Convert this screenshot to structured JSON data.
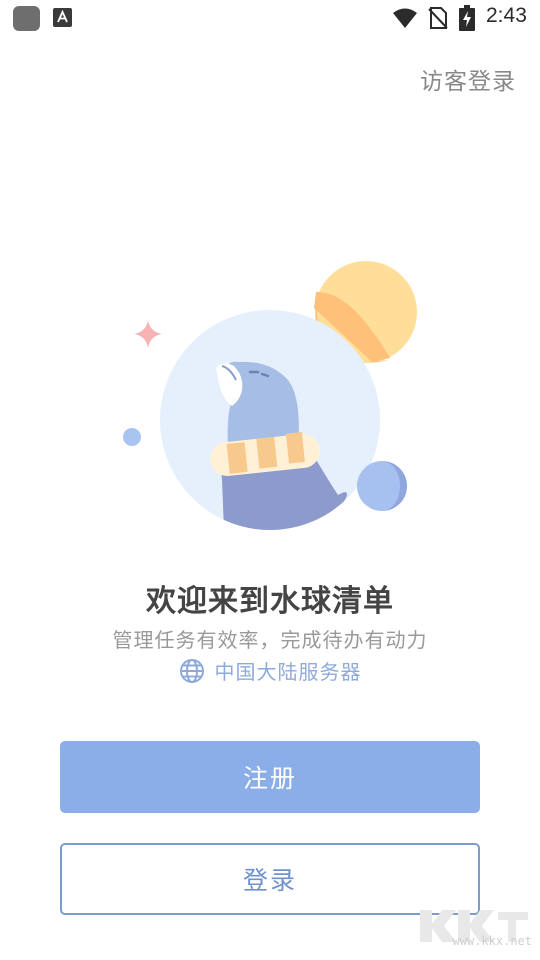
{
  "status_bar": {
    "time": "2:43",
    "icons": [
      "app-icon",
      "font-icon",
      "wifi-icon",
      "no-sim-icon",
      "battery-charging-icon"
    ]
  },
  "header": {
    "guest_login": "访客登录"
  },
  "welcome": {
    "title": "欢迎来到水球清单",
    "subtitle": "管理任务有效率，完成待办有动力",
    "server_icon": "globe-icon",
    "server_label": "中国大陆服务器"
  },
  "actions": {
    "register_label": "注册",
    "login_label": "登录"
  },
  "watermark": {
    "text": "www.kkx.net"
  },
  "colors": {
    "primary": "#8baee9",
    "outline": "#7d9cca",
    "server_text": "#8eaadb",
    "sun": "#ffde9a",
    "sun_shadow": "#ffc17a",
    "circle_bg": "#e6f0fd",
    "seal_body": "#8c9bcc",
    "seal_head": "#a6bde6",
    "ball": "#a6c1f0",
    "sparkle": "#f7b3b3",
    "scarf": "#f8c98c"
  }
}
